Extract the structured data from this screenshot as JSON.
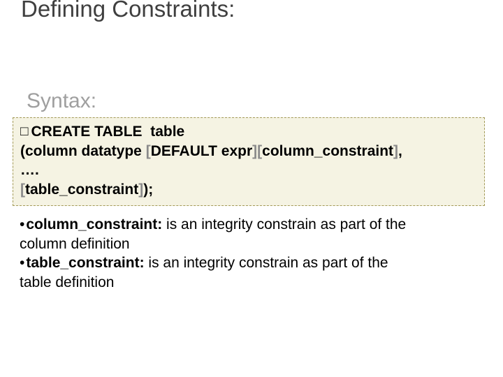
{
  "title": "Defining Constraints:",
  "syntax_label": "Syntax:",
  "code": {
    "checkbox": "□",
    "kw_create": "CREATE TABLE",
    "kw_table_placeholder": "table",
    "line2_pre": "(column datatype ",
    "lbr1": "[",
    "default_expr": "DEFAULT expr",
    "rbr1": "]",
    "lbr2": "[",
    "col_con": "column_constraint",
    "rbr2": "]",
    "comma": ",",
    "dots": "….",
    "lbr3": "[",
    "tab_con": "table_constraint",
    "rbr3": "]",
    "close": ");"
  },
  "desc": {
    "bullet": "•",
    "term1": "column_constraint:",
    "text1a": " is an integrity constrain as part of the",
    "text1b": "column definition",
    "term2": "table_constraint:",
    "text2a": " is an integrity constrain as part of the",
    "text2b": "table definition"
  }
}
